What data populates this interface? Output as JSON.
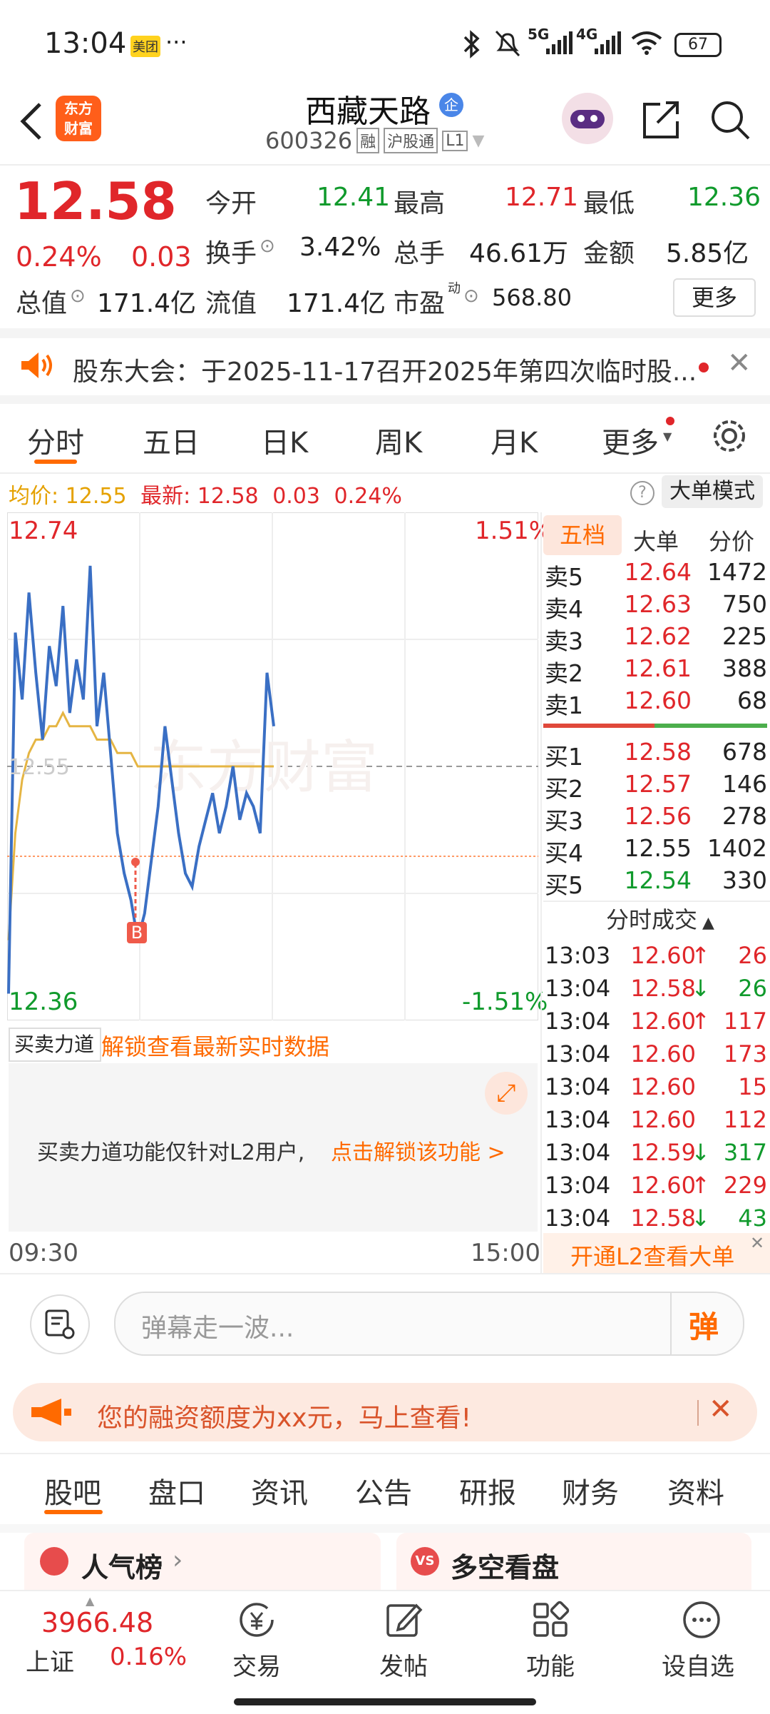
{
  "status": {
    "time": "13:04",
    "app_badge": "美团",
    "dots": "···",
    "net1": "5G",
    "net2": "4G",
    "battery": "67"
  },
  "header": {
    "title": "西藏天路",
    "title_badge": "企",
    "code": "600326",
    "tag1": "融",
    "tag2": "沪股通",
    "tag3": "L1",
    "logo_text_1": "东方",
    "logo_text_2": "财富"
  },
  "quote": {
    "price": "12.58",
    "change_pct": "0.24%",
    "change": "0.03",
    "open_label": "今开",
    "open": "12.41",
    "high_label": "最高",
    "high": "12.71",
    "low_label": "最低",
    "low": "12.36",
    "turnover_label": "换手",
    "turnover": "3.42%",
    "volume_label": "总手",
    "volume": "46.61万",
    "amount_label": "金额",
    "amount": "5.85亿",
    "mcap_label": "总值",
    "mcap": "171.4亿",
    "float_label": "流值",
    "float": "171.4亿",
    "pe_label": "市盈",
    "pe_sup": "动",
    "pe": "568.80",
    "more_button": "更多"
  },
  "notice": {
    "text": "股东大会：于2025-11-17召开2025年第四次临时股..."
  },
  "tabs": {
    "items": [
      "分时",
      "五日",
      "日K",
      "周K",
      "月K",
      "更多"
    ],
    "active": "分时"
  },
  "info_line": {
    "avg_label": "均价:",
    "avg": "12.55",
    "latest_label": "最新:",
    "latest": "12.58",
    "chg": "0.03",
    "pct": "0.24%",
    "mode_button": "大单模式",
    "help": "?"
  },
  "chart_data": {
    "type": "line",
    "y_top": "12.74",
    "y_bottom": "12.36",
    "pct_top": "1.51%",
    "pct_bottom": "-1.51%",
    "mid_label": "12.55",
    "x_start": "09:30",
    "x_end": "15:00",
    "marker": "B",
    "ylim": [
      12.36,
      12.74
    ],
    "price_series": [
      12.38,
      12.65,
      12.6,
      12.68,
      12.62,
      12.57,
      12.64,
      12.61,
      12.67,
      12.59,
      12.63,
      12.6,
      12.7,
      12.58,
      12.62,
      12.56,
      12.5,
      12.47,
      12.45,
      12.42,
      12.44,
      12.48,
      12.52,
      12.58,
      12.54,
      12.5,
      12.47,
      12.46,
      12.49,
      12.51,
      12.53,
      12.5,
      12.52,
      12.55,
      12.51,
      12.53,
      12.52,
      12.5,
      12.62,
      12.58
    ],
    "avg_series": [
      12.42,
      12.5,
      12.54,
      12.56,
      12.57,
      12.57,
      12.58,
      12.58,
      12.59,
      12.58,
      12.58,
      12.58,
      12.58,
      12.57,
      12.57,
      12.57,
      12.56,
      12.56,
      12.56,
      12.55,
      12.55,
      12.55,
      12.55,
      12.55,
      12.55,
      12.55,
      12.55,
      12.55,
      12.55,
      12.55,
      12.55,
      12.55,
      12.55,
      12.55,
      12.55,
      12.55,
      12.55,
      12.55,
      12.55,
      12.55
    ]
  },
  "indicator": {
    "selector": "买卖力道",
    "unlock_link": "解锁查看最新实时数据",
    "lock_text": "买卖力道功能仅针对L2用户,",
    "lock_link": "点击解锁该功能 >"
  },
  "orderbook": {
    "tabs": [
      "五档",
      "大单",
      "分价"
    ],
    "asks": [
      {
        "label": "卖5",
        "price": "12.64",
        "vol": "1472"
      },
      {
        "label": "卖4",
        "price": "12.63",
        "vol": "750"
      },
      {
        "label": "卖3",
        "price": "12.62",
        "vol": "225"
      },
      {
        "label": "卖2",
        "price": "12.61",
        "vol": "388"
      },
      {
        "label": "卖1",
        "price": "12.60",
        "vol": "68"
      }
    ],
    "bids": [
      {
        "label": "买1",
        "price": "12.58",
        "vol": "678"
      },
      {
        "label": "买2",
        "price": "12.57",
        "vol": "146"
      },
      {
        "label": "买3",
        "price": "12.56",
        "vol": "278"
      },
      {
        "label": "买4",
        "price": "12.55",
        "vol": "1402"
      },
      {
        "label": "买5",
        "price": "12.54",
        "vol": "330"
      }
    ],
    "ticks_title": "分时成交",
    "ticks": [
      {
        "time": "13:03",
        "price": "12.60",
        "dir": "↑",
        "vol": "26",
        "pc": "red",
        "vc": "red"
      },
      {
        "time": "13:04",
        "price": "12.58",
        "dir": "↓",
        "vol": "26",
        "pc": "red",
        "vc": "green"
      },
      {
        "time": "13:04",
        "price": "12.60",
        "dir": "↑",
        "vol": "117",
        "pc": "red",
        "vc": "red"
      },
      {
        "time": "13:04",
        "price": "12.60",
        "dir": "",
        "vol": "173",
        "pc": "red",
        "vc": "red"
      },
      {
        "time": "13:04",
        "price": "12.60",
        "dir": "",
        "vol": "15",
        "pc": "red",
        "vc": "red"
      },
      {
        "time": "13:04",
        "price": "12.60",
        "dir": "",
        "vol": "112",
        "pc": "red",
        "vc": "red"
      },
      {
        "time": "13:04",
        "price": "12.59",
        "dir": "↓",
        "vol": "317",
        "pc": "red",
        "vc": "green"
      },
      {
        "time": "13:04",
        "price": "12.60",
        "dir": "↑",
        "vol": "229",
        "pc": "red",
        "vc": "red"
      },
      {
        "time": "13:04",
        "price": "12.58",
        "dir": "↓",
        "vol": "43",
        "pc": "red",
        "vc": "green"
      }
    ],
    "l2_banner": "开通L2查看大单"
  },
  "comment": {
    "placeholder": "弹幕走一波...",
    "send": "弹"
  },
  "promo": {
    "text": "您的融资额度为xx元，马上查看!"
  },
  "sections": {
    "items": [
      "股吧",
      "盘口",
      "资讯",
      "公告",
      "研报",
      "财务",
      "资料"
    ],
    "active": "股吧"
  },
  "cards": {
    "left": "人气榜",
    "right": "多空看盘",
    "right_badge": "VS"
  },
  "bottom": {
    "index_value": "3966.48",
    "index_name": "上证",
    "index_pct": "0.16%",
    "items": [
      "交易",
      "发帖",
      "功能",
      "设自选"
    ]
  }
}
